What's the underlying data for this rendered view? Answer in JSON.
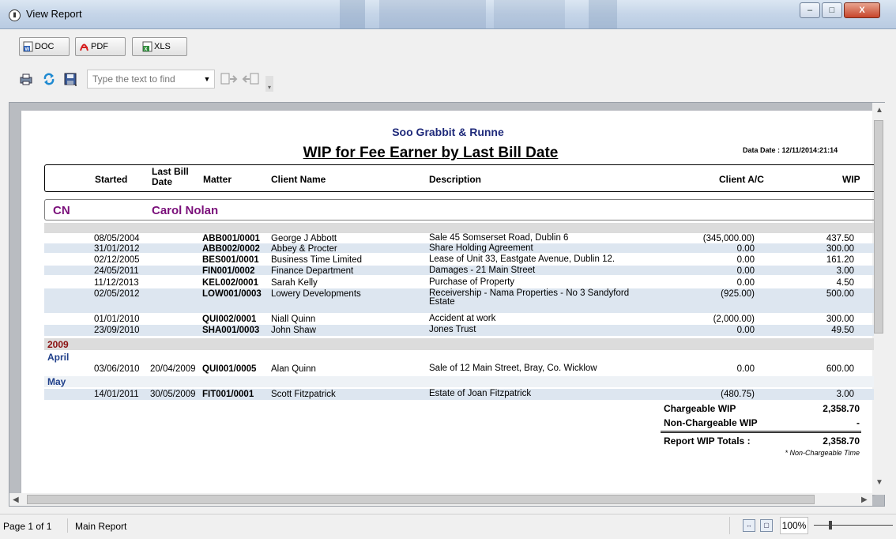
{
  "window": {
    "title": "View Report",
    "minimize_glyph": "–",
    "maximize_glyph": "□",
    "close_glyph": "X"
  },
  "export_buttons": [
    {
      "label": "DOC",
      "icon": "word-doc-icon"
    },
    {
      "label": "PDF",
      "icon": "pdf-icon"
    },
    {
      "label": "XLS",
      "icon": "excel-icon"
    }
  ],
  "toolbar": {
    "find_placeholder": "Type the text to find",
    "icons": [
      "print-icon",
      "refresh-icon",
      "save-icon",
      "dropdown-icon",
      "find-next-icon",
      "find-previous-icon"
    ]
  },
  "report": {
    "firm_name": "Soo Grabbit & Runne",
    "title": "WIP for Fee Earner by Last Bill Date",
    "data_date": "Data Date : 12/11/2014:21:14",
    "columns": {
      "started": "Started",
      "last_bill": "Last Bill\nDate",
      "matter": "Matter",
      "client": "Client Name",
      "description": "Description",
      "client_ac": "Client A/C",
      "wip": "WIP"
    },
    "group": {
      "code": "CN",
      "name": "Carol Nolan"
    },
    "rows": [
      {
        "started": "08/05/2004",
        "last_bill": "",
        "matter": "ABB001/0001",
        "client": "George J Abbott",
        "description": "Sale 45 Somserset Road, Dublin 6",
        "client_ac": "(345,000.00)",
        "wip": "437.50"
      },
      {
        "started": "31/01/2012",
        "last_bill": "",
        "matter": "ABB002/0002",
        "client": "Abbey & Procter",
        "description": "Share Holding Agreement",
        "client_ac": "0.00",
        "wip": "300.00"
      },
      {
        "started": "02/12/2005",
        "last_bill": "",
        "matter": "BES001/0001",
        "client": "Business Time Limited",
        "description": "Lease of Unit 33, Eastgate Avenue, Dublin 12.",
        "client_ac": "0.00",
        "wip": "161.20"
      },
      {
        "started": "24/05/2011",
        "last_bill": "",
        "matter": "FIN001/0002",
        "client": "Finance Department",
        "description": "Damages - 21 Main Street",
        "client_ac": "0.00",
        "wip": "3.00"
      },
      {
        "started": "11/12/2013",
        "last_bill": "",
        "matter": "KEL002/0001",
        "client": "Sarah Kelly",
        "description": "Purchase of Property",
        "client_ac": "0.00",
        "wip": "4.50"
      },
      {
        "started": "02/05/2012",
        "last_bill": "",
        "matter": "LOW001/0003",
        "client": "Lowery Developments",
        "description": "Receivership - Nama Properties - No 3 Sandyford Estate",
        "client_ac": "(925.00)",
        "wip": "500.00"
      },
      {
        "started": "01/01/2010",
        "last_bill": "",
        "matter": "QUI002/0001",
        "client": "Niall Quinn",
        "description": "Accident at work",
        "client_ac": "(2,000.00)",
        "wip": "300.00"
      },
      {
        "started": "23/09/2010",
        "last_bill": "",
        "matter": "SHA001/0003",
        "client": "John Shaw",
        "description": "Jones Trust",
        "client_ac": "0.00",
        "wip": "49.50"
      }
    ],
    "year_label": "2009",
    "months": [
      {
        "label": "April",
        "row": {
          "started": "03/06/2010",
          "last_bill": "20/04/2009",
          "matter": "QUI001/0005",
          "client": "Alan Quinn",
          "description": "Sale of 12 Main Street, Bray, Co. Wicklow",
          "client_ac": "0.00",
          "wip": "600.00"
        }
      },
      {
        "label": "May",
        "row": {
          "started": "14/01/2011",
          "last_bill": "30/05/2009",
          "matter": "FIT001/0001",
          "client": "Scott Fitzpatrick",
          "description": "Estate of Joan Fitzpatrick",
          "client_ac": "(480.75)",
          "wip": "3.00"
        }
      }
    ],
    "totals": {
      "chargeable_label": "Chargeable WIP",
      "chargeable": "2,358.70",
      "non_chargeable_label": "Non-Chargeable WIP",
      "non_chargeable": "-",
      "report_label": "Report WIP Totals :",
      "report": "2,358.70",
      "footnote": "* Non-Chargeable Time"
    }
  },
  "status": {
    "page": "Page 1 of 1",
    "report_name": "Main Report",
    "zoom": "100%"
  }
}
